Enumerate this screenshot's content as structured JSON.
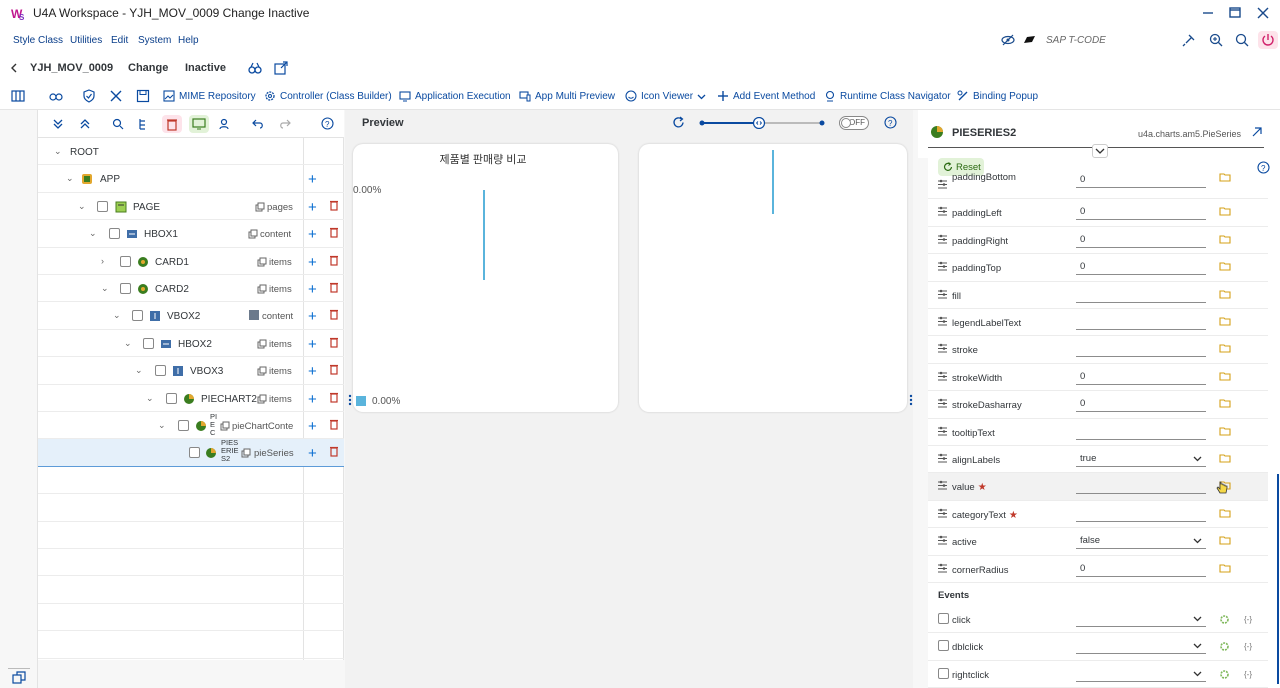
{
  "window": {
    "title": "U4A Workspace - YJH_MOV_0009 Change Inactive",
    "logo_text": "WS",
    "controls": [
      "minimize-icon",
      "maximize-icon",
      "close-icon"
    ]
  },
  "menubar": {
    "items": [
      "Style Class",
      "Utilities",
      "Edit",
      "System",
      "Help"
    ],
    "tcode_label": "SAP T-CODE"
  },
  "app_header": {
    "back": "back-icon",
    "program": "YJH_MOV_0009",
    "mode": "Change",
    "status": "Inactive"
  },
  "toolbar": {
    "items": [
      {
        "label": "MIME Repository",
        "icon": "image-icon"
      },
      {
        "label": "Controller (Class Builder)",
        "icon": "gear-icon"
      },
      {
        "label": "Application Execution",
        "icon": "monitor-icon"
      },
      {
        "label": "App Multi Preview",
        "icon": "devices-icon"
      },
      {
        "label": "Icon Viewer",
        "icon": "smiley-icon"
      },
      {
        "label": "Add Event Method",
        "icon": "add-icon"
      },
      {
        "label": "Runtime Class Navigator",
        "icon": "pin-icon"
      },
      {
        "label": "Binding Popup",
        "icon": "link-icon"
      }
    ]
  },
  "tree": {
    "nodes": [
      {
        "label": "ROOT",
        "agg": ""
      },
      {
        "label": "APP",
        "agg": ""
      },
      {
        "label": "PAGE",
        "agg": "pages"
      },
      {
        "label": "HBOX1",
        "agg": "content"
      },
      {
        "label": "CARD1",
        "agg": "items"
      },
      {
        "label": "CARD2",
        "agg": "items"
      },
      {
        "label": "VBOX2",
        "agg": "content"
      },
      {
        "label": "HBOX2",
        "agg": "items"
      },
      {
        "label": "VBOX3",
        "agg": "items"
      },
      {
        "label": "PIECHART2",
        "agg": "items"
      },
      {
        "label": "PIECHARTCONT",
        "agg": "pieChartConte"
      },
      {
        "label": "PIESERIES2",
        "agg": "pieSeries"
      }
    ]
  },
  "preview": {
    "title": "Preview",
    "toggle_label": "OFF",
    "chart_title": "제품별 판매량 비교",
    "axis_value": "0.00%",
    "legend_value": "0.00%",
    "accent": "#5ab4dc"
  },
  "properties": {
    "control_name": "PIESERIES2",
    "control_class": "u4a.charts.am5.PieSeries",
    "reset_label": "Reset",
    "rows": [
      {
        "name": "paddingBottom",
        "value": "0",
        "type": "input"
      },
      {
        "name": "paddingLeft",
        "value": "0",
        "type": "input"
      },
      {
        "name": "paddingRight",
        "value": "0",
        "type": "input"
      },
      {
        "name": "paddingTop",
        "value": "0",
        "type": "input"
      },
      {
        "name": "fill",
        "value": "",
        "type": "input"
      },
      {
        "name": "legendLabelText",
        "value": "",
        "type": "input"
      },
      {
        "name": "stroke",
        "value": "",
        "type": "input"
      },
      {
        "name": "strokeWidth",
        "value": "0",
        "type": "input"
      },
      {
        "name": "strokeDasharray",
        "value": "0",
        "type": "input"
      },
      {
        "name": "tooltipText",
        "value": "",
        "type": "input"
      },
      {
        "name": "alignLabels",
        "value": "true",
        "type": "select"
      },
      {
        "name": "value",
        "value": "",
        "type": "input",
        "required": true
      },
      {
        "name": "categoryText",
        "value": "",
        "type": "input",
        "required": true
      },
      {
        "name": "active",
        "value": "false",
        "type": "select"
      },
      {
        "name": "cornerRadius",
        "value": "0",
        "type": "input"
      }
    ],
    "events_label": "Events",
    "events": [
      "click",
      "dblclick",
      "rightclick"
    ]
  }
}
